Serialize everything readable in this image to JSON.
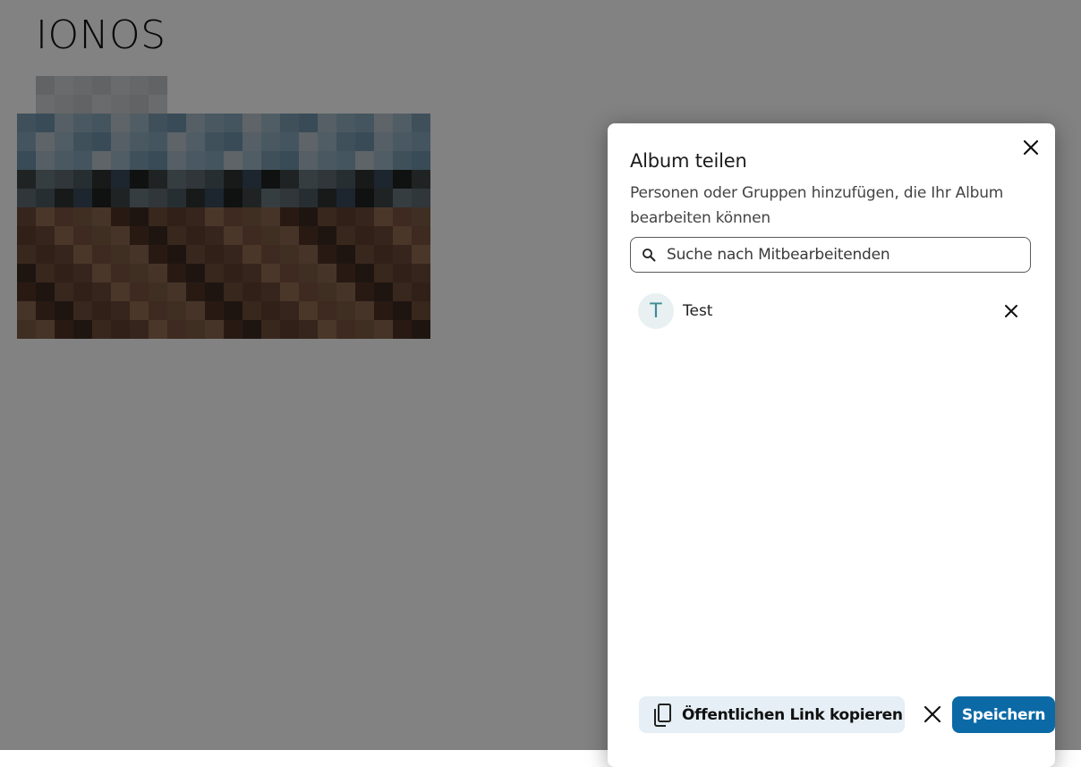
{
  "page": {
    "album_title": "IONOS"
  },
  "dialog": {
    "title": "Album teilen",
    "description": "Personen oder Gruppen hinzufügen, die Ihr Album bearbeiten können",
    "search": {
      "placeholder": "Suche nach Mitbearbeitenden",
      "icon": "search-icon"
    },
    "members": [
      {
        "initial": "T",
        "name": "Test"
      }
    ],
    "footer": {
      "copy_link_label": "Öffentlichen Link kopieren",
      "copy_icon": "copy-icon",
      "save_label": "Speichern"
    }
  },
  "colors": {
    "primary": "#0b6aa6",
    "copy_button_bg": "#e5eff5",
    "avatar_bg": "#e8f0f2",
    "avatar_text": "#3f8a98",
    "overlay": "rgba(0,0,0,0.49)"
  }
}
